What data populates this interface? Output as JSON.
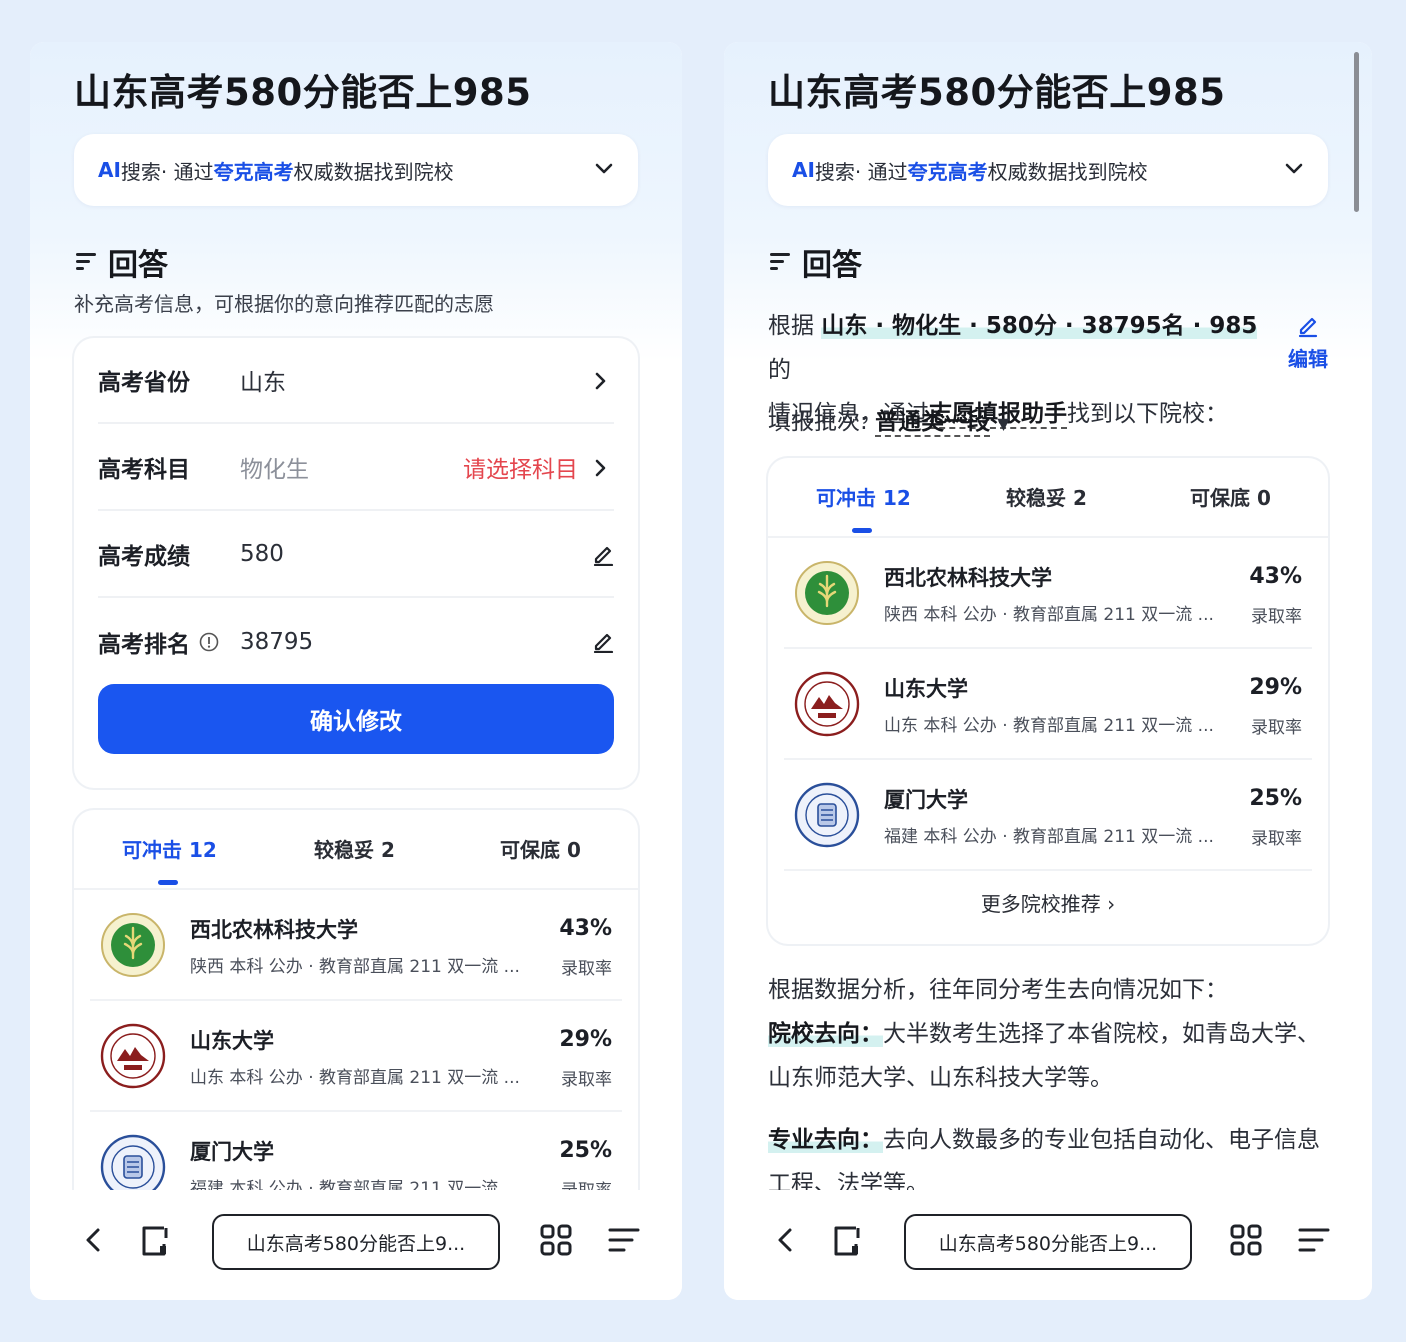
{
  "title": "山东高考580分能否上985",
  "ai_bar": {
    "ai": "AI",
    "label": "搜索",
    "sep": " · 通过",
    "brand": "夸克高考",
    "rest": "权威数据找到院校"
  },
  "answer_heading": "回答",
  "left": {
    "subtitle": "补充高考信息，可根据你的意向推荐匹配的志愿",
    "form": {
      "province_label": "高考省份",
      "province_value": "山东",
      "subject_label": "高考科目",
      "subject_value": "物化生",
      "subject_warning": "请选择科目",
      "score_label": "高考成绩",
      "score_value": "580",
      "rank_label": "高考排名",
      "rank_value": "38795",
      "confirm": "确认修改"
    }
  },
  "tabs": {
    "reach": "可冲击 12",
    "stable": "较稳妥 2",
    "safe": "可保底 0"
  },
  "universities": [
    {
      "name": "西北农林科技大学",
      "meta": "陕西 本科 公办 · 教育部直属 211 双一流 ...",
      "pct": "43%",
      "rate_label": "录取率",
      "logo_color": "#2e8f3a"
    },
    {
      "name": "山东大学",
      "meta": "山东 本科 公办 · 教育部直属 211 双一流 ...",
      "pct": "29%",
      "rate_label": "录取率",
      "logo_color": "#8b1e1e"
    },
    {
      "name": "厦门大学",
      "meta": "福建 本科 公办 · 教育部直属 211 双一流 ...",
      "pct": "25%",
      "rate_label": "录取率",
      "logo_color": "#2a4f9a"
    }
  ],
  "right": {
    "intro_prefix": "根据 ",
    "intro_tags": "山东 · 物化生 · 580分 · 38795名 · 985",
    "intro_suffix": " 的",
    "intro_line2_prefix": "情况信息，通过",
    "intro_line2_tool": "志愿填报助手",
    "intro_line2_suffix": "找到以下院校：",
    "edit": "编辑",
    "batch_label": "填报批次: ",
    "batch_value": "普通类一段",
    "more": "更多院校推荐 ›",
    "analysis_intro": "根据数据分析，往年同分考生去向情况如下：",
    "school_label": "院校去向：",
    "school_text": "大半数考生选择了本省院校，如青岛大学、山东师范大学、山东科技大学等。",
    "major_label": "专业去向：",
    "major_text": "去向人数最多的专业包括自动化、电子信息工程、法学等。"
  },
  "bottom_bar": {
    "query": "山东高考580分能否上9..."
  },
  "colors": {
    "accent": "#1a56f0",
    "warning": "#e4464e",
    "highlight": "#d4f1f0"
  }
}
